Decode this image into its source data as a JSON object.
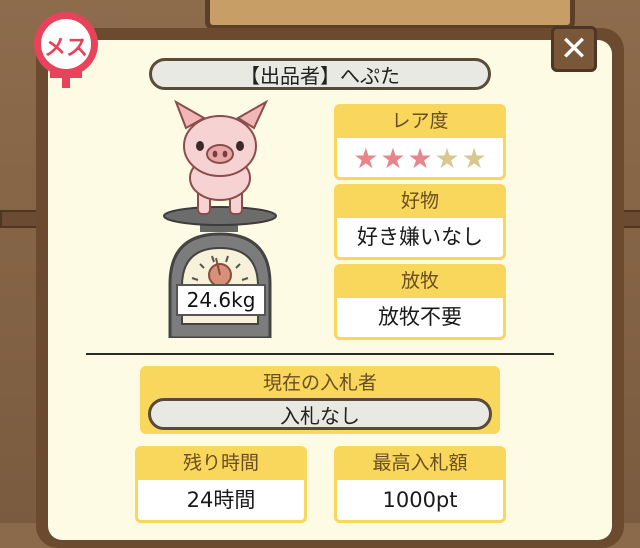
{
  "seller": {
    "label": "【出品者】へぷた"
  },
  "gender": {
    "label": "メス",
    "color": "#e8435a"
  },
  "pig": {
    "weight": "24.6kg"
  },
  "rarity": {
    "label": "レア度",
    "stars_filled": 3,
    "stars_total": 5,
    "star_glyph": "★",
    "filled_color": "#e8858a",
    "empty_color": "#d9c791"
  },
  "favorite": {
    "label": "好物",
    "value": "好き嫌いなし"
  },
  "grazing": {
    "label": "放牧",
    "value": "放牧不要"
  },
  "bidder": {
    "label": "現在の入札者",
    "value": "入札なし"
  },
  "time_left": {
    "label": "残り時間",
    "value": "24時間"
  },
  "max_bid": {
    "label": "最高入札額",
    "value": "1000pt"
  },
  "close_button": {
    "glyph": "✕"
  }
}
